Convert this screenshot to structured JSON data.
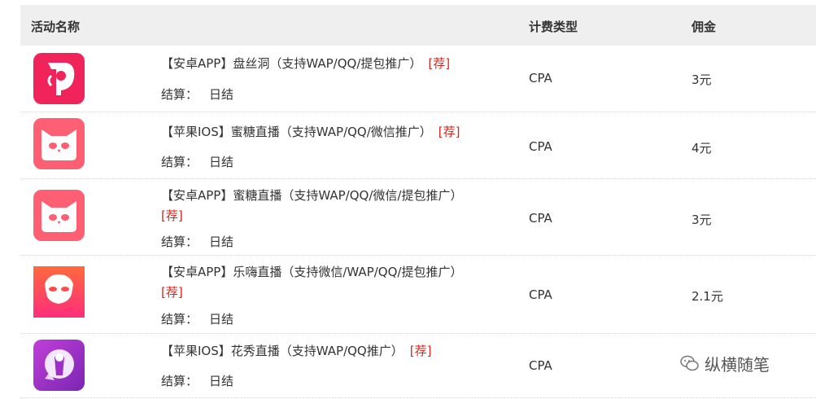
{
  "header": {
    "name": "活动名称",
    "type": "计费类型",
    "commission": "佣金"
  },
  "rows": [
    {
      "title": "【安卓APP】盘丝洞（支持WAP/QQ/提包推广）",
      "tag": "[荐]",
      "settle_label": "结算：",
      "settle_value": "日结",
      "type": "CPA",
      "commission": "3元",
      "icon": "pansidong-app-icon",
      "icon_color": "#f0245a"
    },
    {
      "title": "【苹果IOS】蜜糖直播（支持WAP/QQ/微信推广）",
      "tag": "[荐]",
      "settle_label": "结算：",
      "settle_value": "日结",
      "type": "CPA",
      "commission": "4元",
      "icon": "mitang-cat-app-icon",
      "icon_color": "#ff5f72"
    },
    {
      "title": "【安卓APP】蜜糖直播（支持WAP/QQ/微信/提包推广）",
      "tag": "[荐]",
      "settle_label": "结算：",
      "settle_value": "日结",
      "type": "CPA",
      "commission": "3元",
      "icon": "mitang-cat-app-icon",
      "icon_color": "#ff5f72"
    },
    {
      "title": "【安卓APP】乐嗨直播（支持微信/WAP/QQ/提包推广）",
      "tag": "[荐]",
      "settle_label": "结算：",
      "settle_value": "日结",
      "type": "CPA",
      "commission": "2.1元",
      "icon": "lehai-mask-app-icon",
      "icon_color": "#ff4a4a"
    },
    {
      "title": "【苹果IOS】花秀直播（支持WAP/QQ推广）",
      "tag": "[荐]",
      "settle_label": "结算：",
      "settle_value": "日结",
      "type": "CPA",
      "commission": "",
      "icon": "huaxiu-app-icon",
      "icon_color": "#9b2fc6"
    }
  ],
  "watermark": "纵横随笔",
  "colors": {
    "header_bg": "#efefef",
    "recommend_tag": "#d9251d"
  }
}
